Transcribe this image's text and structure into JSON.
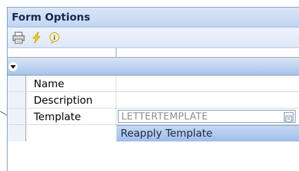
{
  "panel": {
    "title": "Form Options"
  },
  "toolbar": {
    "buttons": [
      {
        "icon": "printer-icon"
      },
      {
        "icon": "lightning-icon"
      },
      {
        "icon": "info-icon"
      }
    ]
  },
  "properties": {
    "rows": [
      {
        "label": "Name",
        "value": ""
      },
      {
        "label": "Description",
        "value": ""
      },
      {
        "label": "Template",
        "value": "LETTERTEMPLATE"
      }
    ],
    "reapply_label": "Reapply Template"
  },
  "colors": {
    "header_bg": "#c2d5f1",
    "group_bg": "#a8c3ea",
    "accent": "#7f9db9"
  }
}
